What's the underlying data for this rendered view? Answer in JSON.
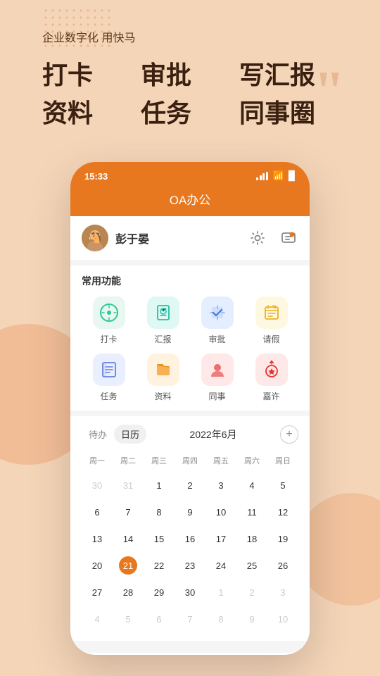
{
  "background": {
    "color": "#f5d5b8"
  },
  "hero": {
    "subtitle": "企业数字化 用快马",
    "items": [
      "打卡",
      "审批",
      "写汇报",
      "资料",
      "任务",
      "同事圈"
    ]
  },
  "phone": {
    "status_bar": {
      "time": "15:33"
    },
    "nav": {
      "title": "OA办公"
    },
    "user": {
      "name": "彭于晏"
    },
    "functions": {
      "section_title": "常用功能",
      "items": [
        {
          "id": "daka",
          "label": "打卡",
          "icon_color": "#e8f5f0",
          "icon_text": "🕐"
        },
        {
          "id": "huibao",
          "label": "汇报",
          "icon_color": "#e0f5f0",
          "icon_text": "📋"
        },
        {
          "id": "shenpi",
          "label": "审批",
          "icon_color": "#e0eeff",
          "icon_text": "🔖"
        },
        {
          "id": "qingjia",
          "label": "请假",
          "icon_color": "#fff8e0",
          "icon_text": "📝"
        },
        {
          "id": "renwu",
          "label": "任务",
          "icon_color": "#e8f0ff",
          "icon_text": "📋"
        },
        {
          "id": "ziliao",
          "label": "资料",
          "icon_color": "#fff3e0",
          "icon_text": "📁"
        },
        {
          "id": "tongshi",
          "label": "同事",
          "icon_color": "#ffe8e8",
          "icon_text": "👤"
        },
        {
          "id": "jiaxu",
          "label": "嘉许",
          "icon_color": "#ffe8e8",
          "icon_text": "🏅"
        }
      ]
    },
    "calendar": {
      "tabs": [
        {
          "label": "待办",
          "active": false
        },
        {
          "label": "日历",
          "active": true
        }
      ],
      "month": "2022年6月",
      "weekdays": [
        "周一",
        "周二",
        "周三",
        "周四",
        "周五",
        "周六",
        "周日"
      ],
      "weeks": [
        [
          {
            "day": 30,
            "other": true
          },
          {
            "day": 31,
            "other": true
          },
          {
            "day": 1
          },
          {
            "day": 2
          },
          {
            "day": 3
          },
          {
            "day": 4
          },
          {
            "day": 5
          }
        ],
        [
          {
            "day": 6
          },
          {
            "day": 7
          },
          {
            "day": 8
          },
          {
            "day": 9
          },
          {
            "day": 10
          },
          {
            "day": 11
          },
          {
            "day": 12
          }
        ],
        [
          {
            "day": 13
          },
          {
            "day": 14
          },
          {
            "day": 15
          },
          {
            "day": 16
          },
          {
            "day": 17
          },
          {
            "day": 18
          },
          {
            "day": 19
          }
        ],
        [
          {
            "day": 20
          },
          {
            "day": 21,
            "today": true
          },
          {
            "day": 22
          },
          {
            "day": 23
          },
          {
            "day": 24
          },
          {
            "day": 25
          },
          {
            "day": 26
          }
        ],
        [
          {
            "day": 27
          },
          {
            "day": 28
          },
          {
            "day": 29
          },
          {
            "day": 30
          },
          {
            "day": 1,
            "other": true
          },
          {
            "day": 2,
            "other": true
          },
          {
            "day": 3,
            "other": true
          }
        ],
        [
          {
            "day": 4,
            "other": true
          },
          {
            "day": 5,
            "other": true
          },
          {
            "day": 6,
            "other": true
          },
          {
            "day": 7,
            "other": true
          },
          {
            "day": 8,
            "other": true
          },
          {
            "day": 9,
            "other": true
          },
          {
            "day": 10,
            "other": true
          }
        ]
      ],
      "add_button": "+"
    }
  }
}
